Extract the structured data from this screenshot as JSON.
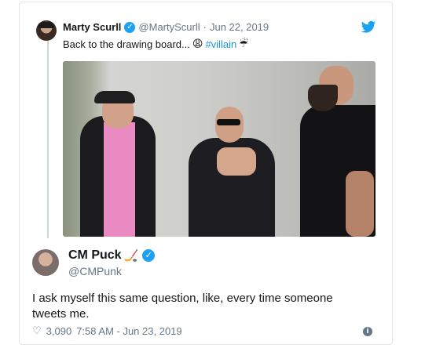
{
  "quoted_tweet": {
    "name": "Marty Scurll",
    "handle": "@MartyScurll",
    "separator": "·",
    "date": "Jun 22, 2019",
    "text": "Back to the drawing board...",
    "emoji_face": "😩",
    "hashtag": "#villain",
    "emoji_umbrella": "☔"
  },
  "main_tweet": {
    "name": "CM Puck",
    "name_emoji": "🏒",
    "handle": "@CMPunk",
    "text": "I ask myself this same question, like, every time someone tweets me.",
    "likes": "3,090",
    "timestamp": "7:58 AM - Jun 23, 2019"
  },
  "icons": {
    "verified": "verified-badge",
    "twitter": "twitter-bird-icon",
    "heart": "heart-icon",
    "info": "info-icon"
  },
  "colors": {
    "accent": "#1da1f2",
    "hashtag": "#1b95e0",
    "muted": "#657786",
    "border": "#e1e8ed"
  }
}
